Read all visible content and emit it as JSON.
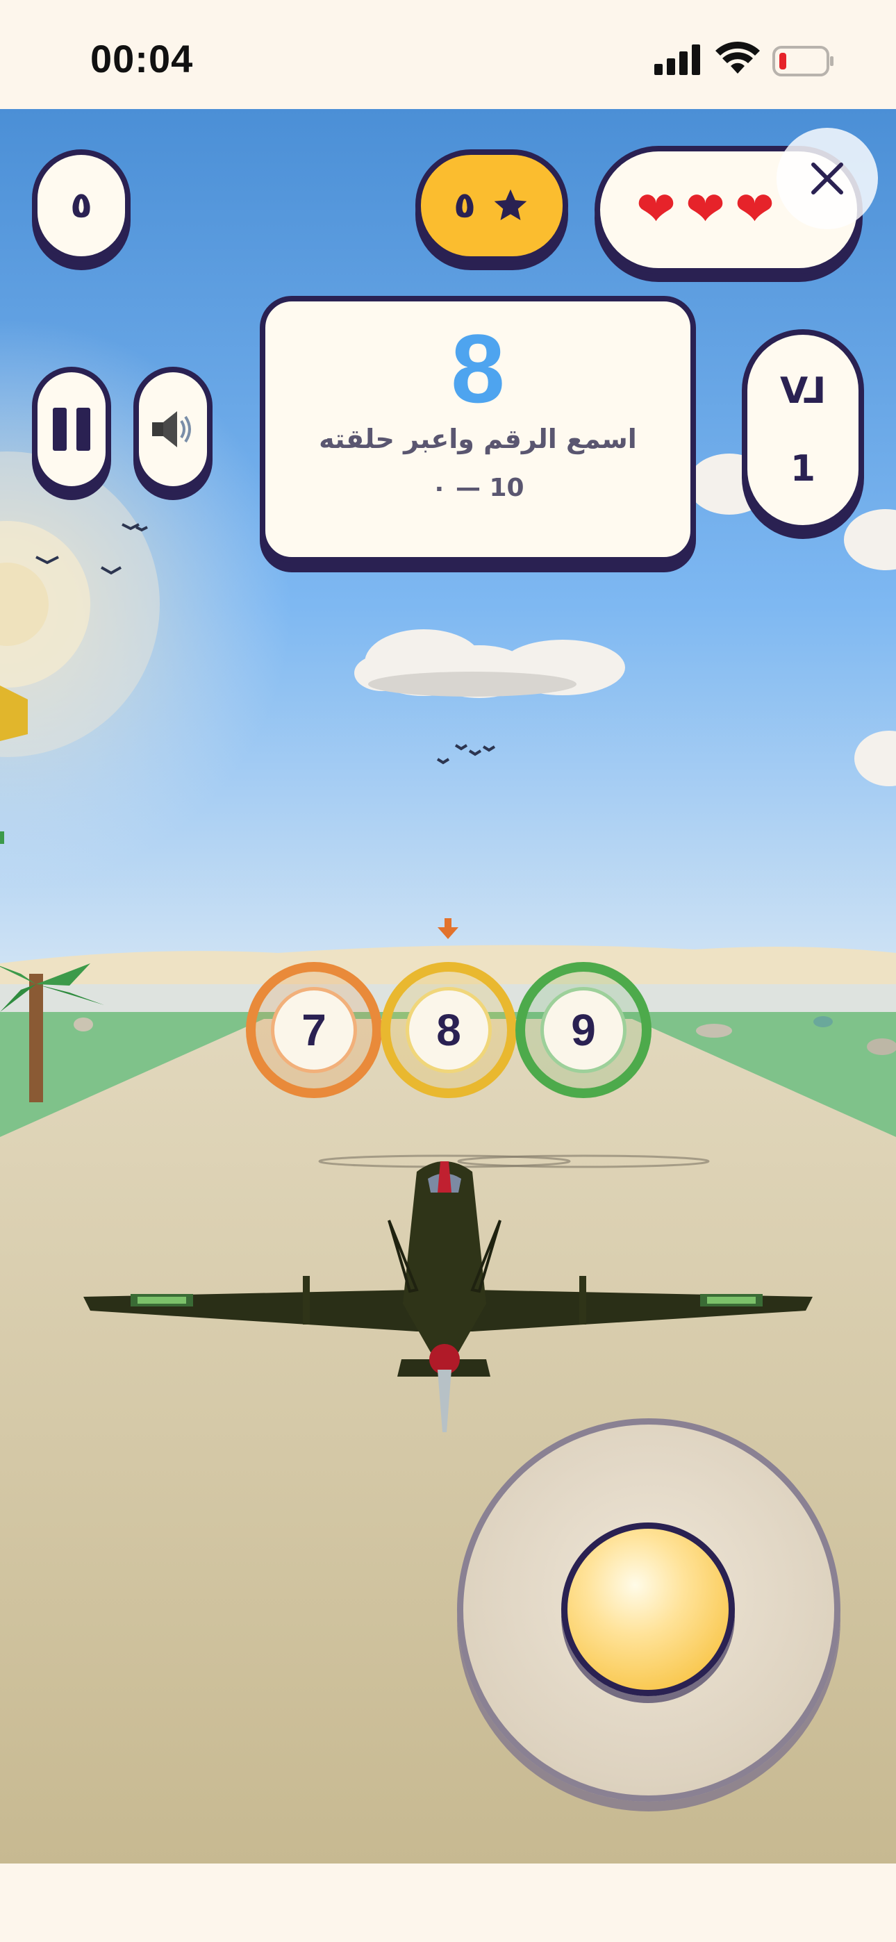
{
  "status_bar": {
    "time": "00:04"
  },
  "hud": {
    "score": "٥",
    "stars": {
      "value": "٥",
      "icon": "star-icon"
    },
    "lives": {
      "count": 3,
      "icon": "heart-icon"
    },
    "close_icon": "close-icon",
    "pause_icon": "pause-icon",
    "sound_icon": "speaker-icon",
    "level": {
      "label": "LV",
      "value": "1"
    }
  },
  "prompt": {
    "number": "8",
    "instruction": "اسمع الرقم واعبر حلقته",
    "range": "٠ — 10"
  },
  "rings": [
    {
      "number": "7",
      "color": "#e98a3a"
    },
    {
      "number": "8",
      "color": "#e9b82f"
    },
    {
      "number": "9",
      "color": "#4daa4b"
    }
  ],
  "colors": {
    "accent": "#2a2152",
    "prompt_number": "#4ea4ef",
    "stars_bg": "#fbbd2f"
  }
}
